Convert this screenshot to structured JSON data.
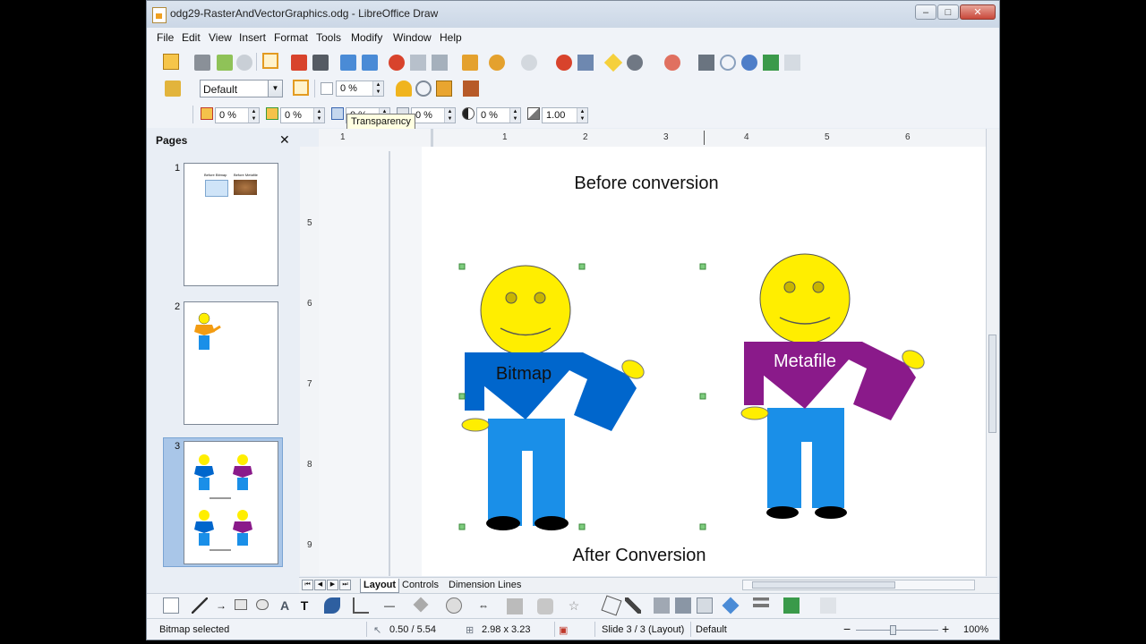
{
  "window": {
    "title": "odg29-RasterAndVectorGraphics.odg - LibreOffice Draw",
    "min": "–",
    "max": "□",
    "close": "✕"
  },
  "menu": [
    "File",
    "Edit",
    "View",
    "Insert",
    "Format",
    "Tools",
    "Modify",
    "Window",
    "Help"
  ],
  "toolbar": {
    "style_value": "Default",
    "transparency_value": "0 %",
    "tooltip": "Transparency",
    "spin_values": [
      "0 %",
      "0 %",
      "0 %",
      "0 %",
      "0 %",
      "0 %",
      "1.00"
    ]
  },
  "pages_panel": {
    "title": "Pages",
    "close": "✕",
    "page_numbers": [
      "1",
      "2",
      "3"
    ]
  },
  "ruler": {
    "h_marks": [
      "1",
      "1",
      "2",
      "3",
      "4",
      "5",
      "6"
    ],
    "v_marks": [
      "5",
      "6",
      "7",
      "8",
      "9"
    ]
  },
  "slide": {
    "title_before": "Before conversion",
    "title_after": "After Conversion",
    "figure_left_label": "Bitmap",
    "figure_right_label": "Metafile",
    "colors": {
      "head": "#ffee00",
      "shirt_left": "#0066cc",
      "shirt_right": "#8a1a8a",
      "pants": "#1a8fe8"
    }
  },
  "thumb": {
    "p1_left": "Before Bitmap",
    "p1_right": "Before Metafile"
  },
  "tabs": [
    "Layout",
    "Controls",
    "Dimension Lines"
  ],
  "status": {
    "selection": "Bitmap selected",
    "position": "0.50 / 5.54",
    "size": "2.98 x 3.23",
    "slide": "Slide 3 / 3 (Layout)",
    "master": "Default",
    "zoom": "100%"
  }
}
